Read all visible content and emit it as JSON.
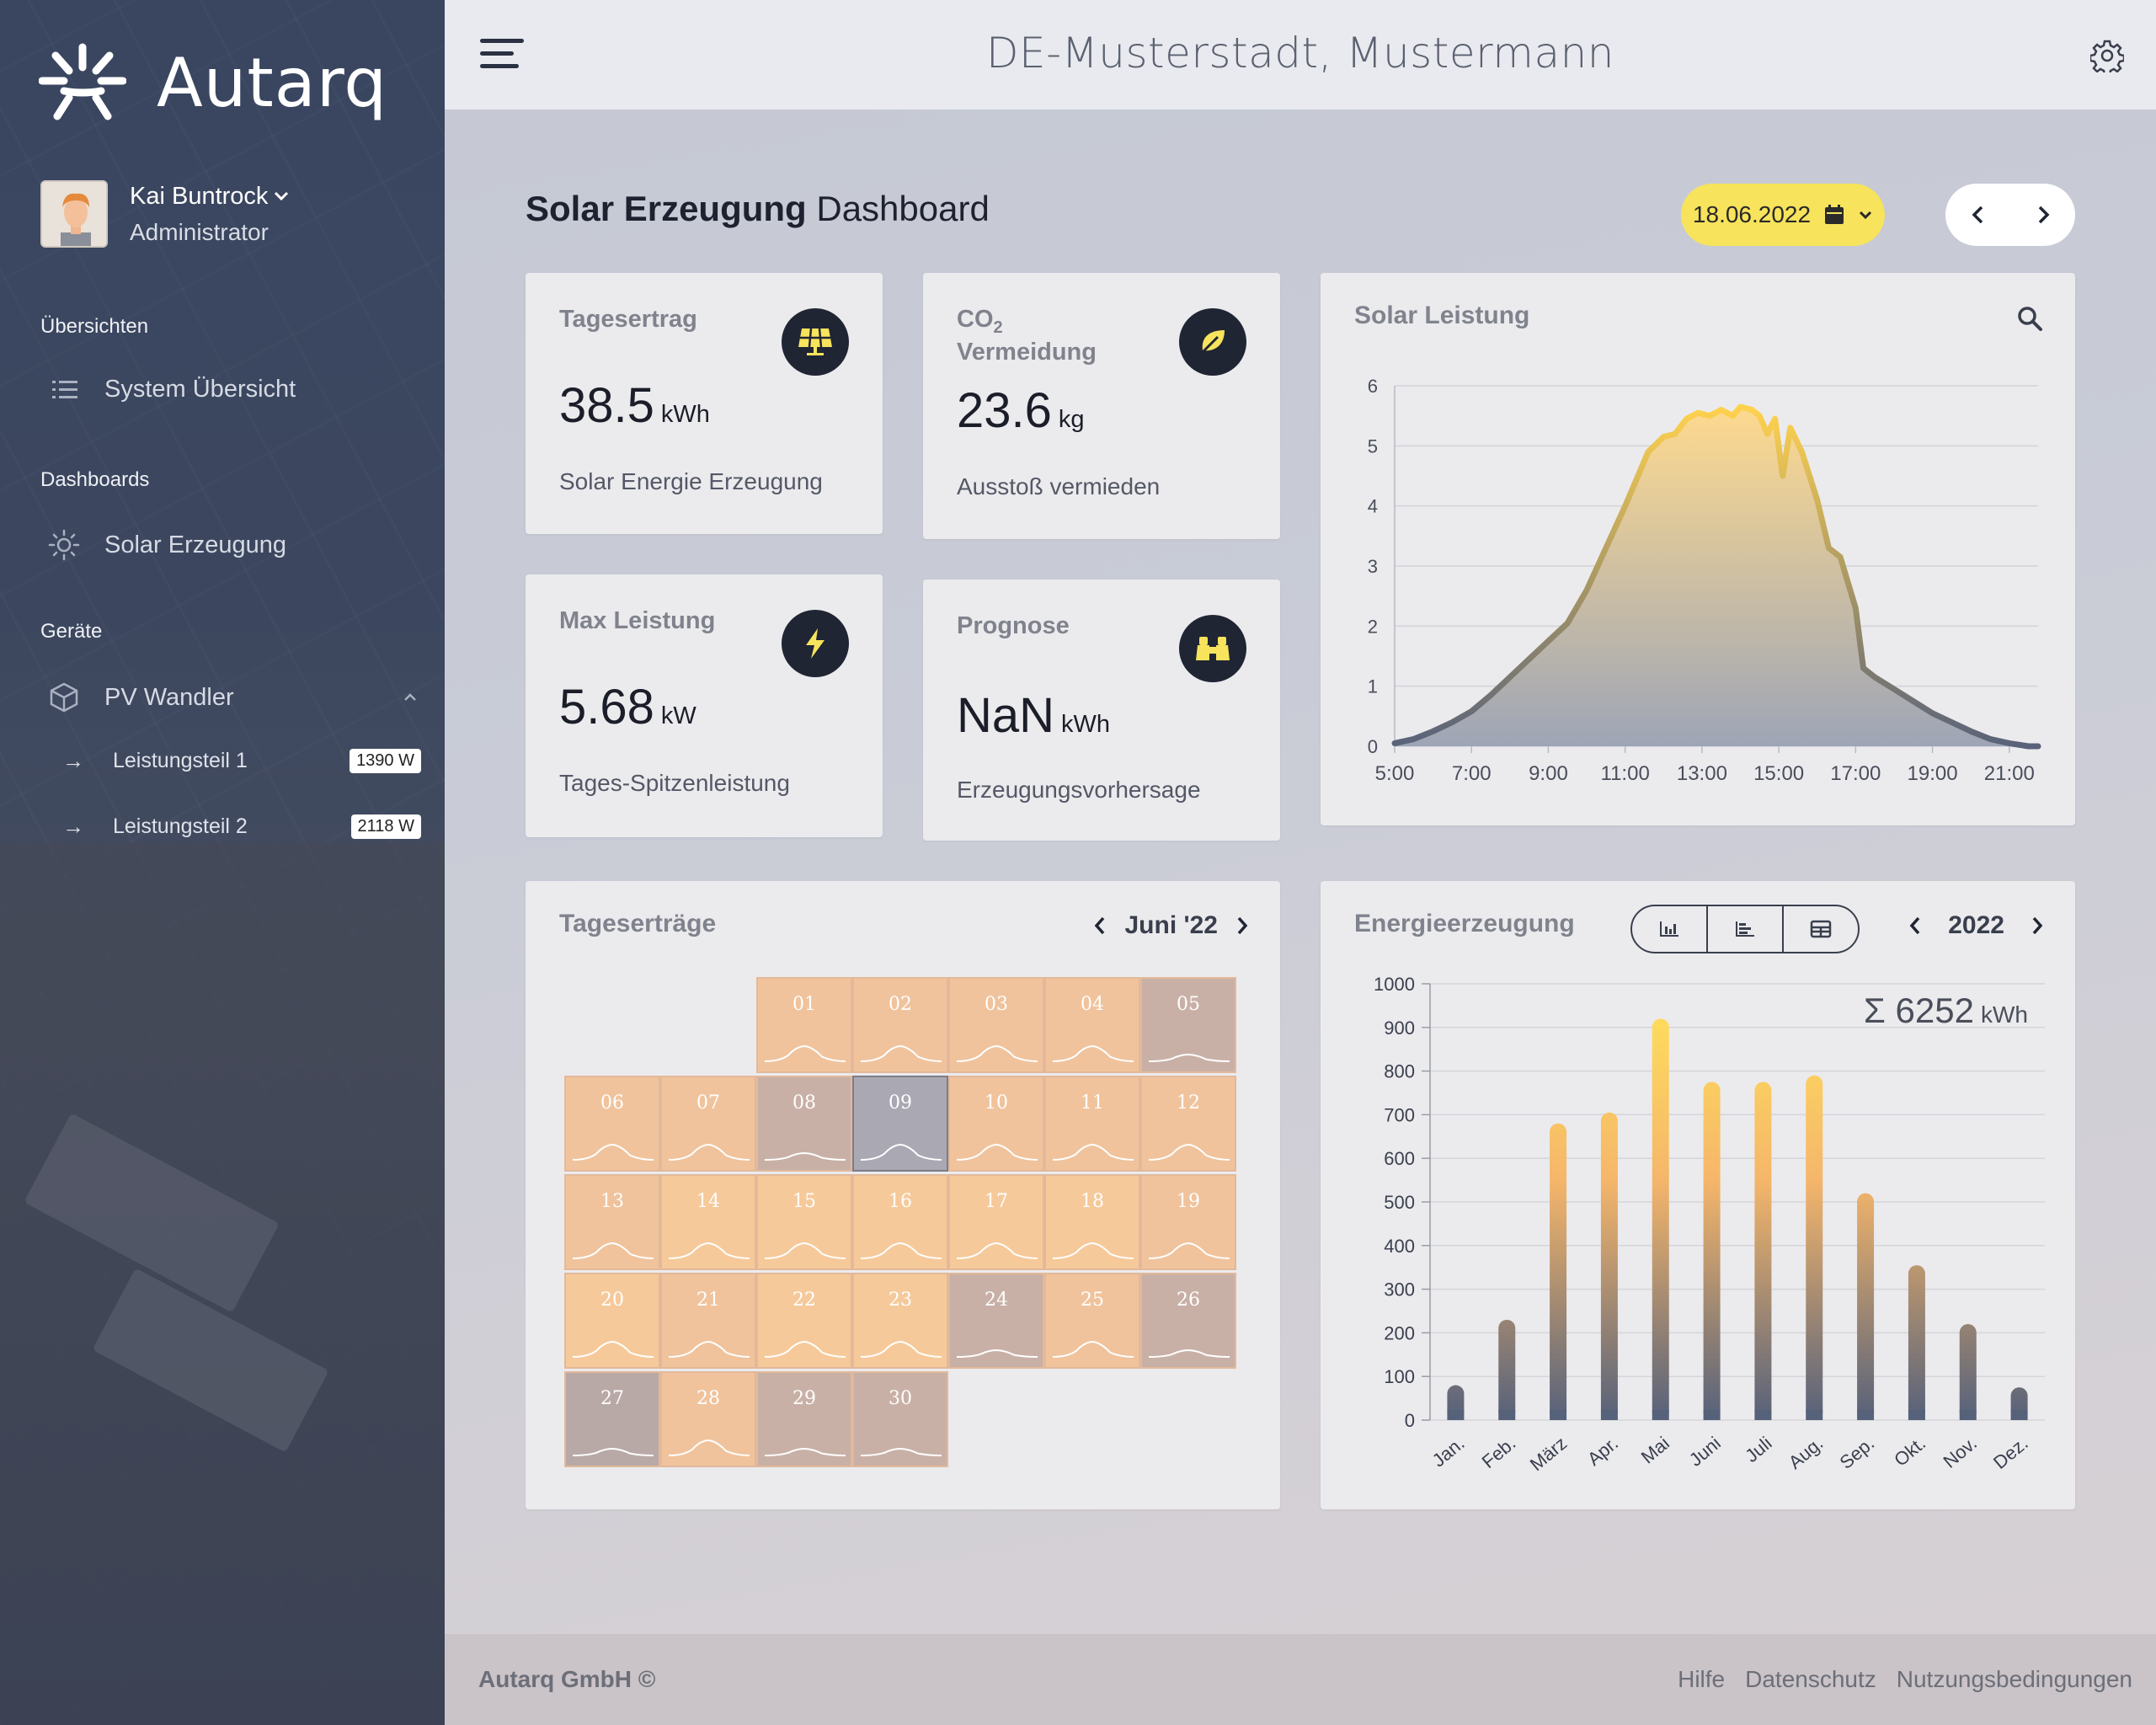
{
  "brand": {
    "name": "Autarq"
  },
  "user": {
    "name": "Kai Buntrock",
    "role": "Administrator"
  },
  "sidebar": {
    "sections": [
      {
        "title": "Übersichten",
        "items": [
          {
            "label": "System Übersicht",
            "icon": "list-icon"
          }
        ]
      },
      {
        "title": "Dashboards",
        "items": [
          {
            "label": "Solar Erzeugung",
            "icon": "sun-icon"
          }
        ]
      },
      {
        "title": "Geräte",
        "items": [
          {
            "label": "PV Wandler",
            "icon": "cube-icon"
          }
        ]
      }
    ],
    "subitems": [
      {
        "label": "Leistungsteil 1",
        "badge": "1390 W"
      },
      {
        "label": "Leistungsteil 2",
        "badge": "2118 W"
      }
    ]
  },
  "header": {
    "title": "DE-Musterstadt, Mustermann"
  },
  "dashboard": {
    "title_bold": "Solar Erzeugung",
    "title_rest": " Dashboard",
    "date": "18.06.2022"
  },
  "kpis": {
    "tagesertrag": {
      "label": "Tagesertrag",
      "value": "38.5",
      "unit": "kWh",
      "desc": "Solar Energie Erzeugung"
    },
    "co2": {
      "label_main": "CO",
      "label_sub": "2",
      "label_line2": "Vermeidung",
      "value": "23.6",
      "unit": "kg",
      "desc": "Ausstoß vermieden"
    },
    "max": {
      "label": "Max Leistung",
      "value": "5.68",
      "unit": "kW",
      "desc": "Tages-Spitzenleistung"
    },
    "prognose": {
      "label": "Prognose",
      "value": "NaN",
      "unit": "kWh",
      "desc": "Erzeugungsvorhersage"
    }
  },
  "calendar": {
    "title": "Tageserträge",
    "month": "Juni '22",
    "start_offset": 2,
    "days": [
      {
        "d": "01",
        "t": "warm"
      },
      {
        "d": "02",
        "t": "warm"
      },
      {
        "d": "03",
        "t": "warm"
      },
      {
        "d": "04",
        "t": "warm"
      },
      {
        "d": "05",
        "t": "grey"
      },
      {
        "d": "06",
        "t": "warm"
      },
      {
        "d": "07",
        "t": "warm"
      },
      {
        "d": "08",
        "t": "grey"
      },
      {
        "d": "09",
        "t": "sel"
      },
      {
        "d": "10",
        "t": "warm"
      },
      {
        "d": "11",
        "t": "warm"
      },
      {
        "d": "12",
        "t": "warm"
      },
      {
        "d": "13",
        "t": "warm"
      },
      {
        "d": "14",
        "t": "hot"
      },
      {
        "d": "15",
        "t": "hot"
      },
      {
        "d": "16",
        "t": "hot"
      },
      {
        "d": "17",
        "t": "hot"
      },
      {
        "d": "18",
        "t": "hot"
      },
      {
        "d": "19",
        "t": "warm"
      },
      {
        "d": "20",
        "t": "hot"
      },
      {
        "d": "21",
        "t": "warm"
      },
      {
        "d": "22",
        "t": "hot"
      },
      {
        "d": "23",
        "t": "hot"
      },
      {
        "d": "24",
        "t": "grey"
      },
      {
        "d": "25",
        "t": "warm"
      },
      {
        "d": "26",
        "t": "grey"
      },
      {
        "d": "27",
        "t": "dark"
      },
      {
        "d": "28",
        "t": "warm"
      },
      {
        "d": "29",
        "t": "grey"
      },
      {
        "d": "30",
        "t": "grey"
      }
    ]
  },
  "energy": {
    "title": "Energieerzeugung",
    "year": "2022",
    "sum": "Σ 6252",
    "sum_unit": "kWh"
  },
  "footer": {
    "copy": "Autarq GmbH ©",
    "links": [
      "Hilfe",
      "Datenschutz",
      "Nutzungsbedingungen"
    ]
  },
  "colors": {
    "accent": "#f7e35c",
    "dark": "#1f2533",
    "warm": "#f3c396",
    "grey": "#c7aea3"
  },
  "chart_data": [
    {
      "type": "area",
      "title": "Solar Leistung",
      "x_ticks": [
        "5:00",
        "7:00",
        "9:00",
        "11:00",
        "13:00",
        "15:00",
        "17:00",
        "19:00",
        "21:00"
      ],
      "y_ticks": [
        "0",
        "1",
        "2",
        "3",
        "4",
        "5",
        "6"
      ],
      "xlim": [
        5,
        21.75
      ],
      "ylim": [
        0,
        6
      ],
      "x": [
        5,
        5.5,
        6,
        6.5,
        7,
        7.5,
        8,
        8.5,
        9,
        9.5,
        10,
        10.5,
        11,
        11.3,
        11.6,
        12,
        12.3,
        12.6,
        12.9,
        13.2,
        13.5,
        13.8,
        14,
        14.3,
        14.5,
        14.7,
        14.9,
        15.1,
        15.3,
        15.6,
        16,
        16.3,
        16.6,
        17,
        17.2,
        17.5,
        18,
        18.5,
        19,
        19.5,
        20,
        20.5,
        21,
        21.5,
        21.75
      ],
      "values": [
        0.05,
        0.12,
        0.25,
        0.4,
        0.58,
        0.85,
        1.15,
        1.45,
        1.75,
        2.05,
        2.6,
        3.3,
        4.0,
        4.45,
        4.9,
        5.15,
        5.2,
        5.45,
        5.55,
        5.5,
        5.6,
        5.5,
        5.65,
        5.6,
        5.5,
        5.2,
        5.45,
        4.5,
        5.3,
        4.9,
        4.1,
        3.3,
        3.15,
        2.3,
        1.3,
        1.15,
        0.95,
        0.75,
        0.55,
        0.4,
        0.25,
        0.12,
        0.05,
        0.0,
        0.0
      ]
    },
    {
      "type": "bar",
      "title": "Energieerzeugung",
      "categories": [
        "Jan.",
        "Feb.",
        "März",
        "Apr.",
        "Mai",
        "Juni",
        "Juli",
        "Aug.",
        "Sep.",
        "Okt.",
        "Nov.",
        "Dez."
      ],
      "values": [
        80,
        230,
        680,
        705,
        920,
        775,
        775,
        790,
        520,
        355,
        220,
        75
      ],
      "y_ticks": [
        "0",
        "100",
        "200",
        "300",
        "400",
        "500",
        "600",
        "700",
        "800",
        "900",
        "1000"
      ],
      "ylim": [
        0,
        1000
      ]
    }
  ]
}
